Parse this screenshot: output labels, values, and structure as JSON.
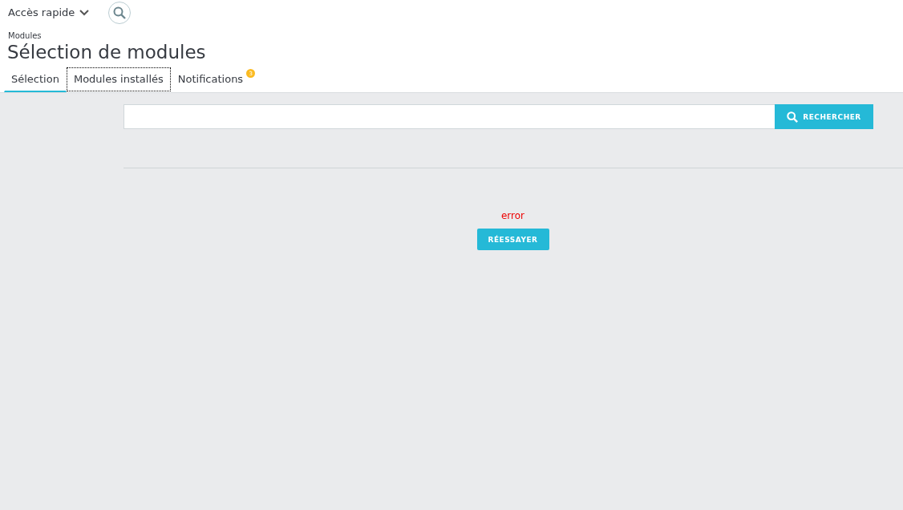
{
  "header": {
    "quick_access": "Accès rapide"
  },
  "breadcrumb": "Modules",
  "title": "Sélection de modules",
  "tabs": [
    {
      "label": "Sélection",
      "selected": true,
      "focused": false
    },
    {
      "label": "Modules installés",
      "selected": false,
      "focused": true
    },
    {
      "label": "Notifications",
      "selected": false,
      "focused": false,
      "badge": "3"
    }
  ],
  "search": {
    "button": "RECHERCHER"
  },
  "error": {
    "message": "error",
    "button": "RÉESSAYER"
  }
}
